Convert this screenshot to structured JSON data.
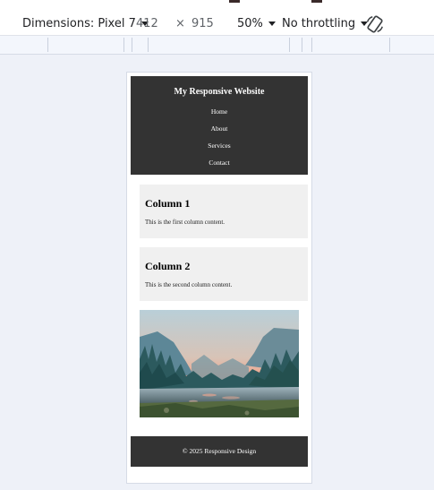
{
  "devtools": {
    "dimensions_label": "Dimensions: Pixel 7",
    "width": "412",
    "times": "×",
    "height": "915",
    "zoom": "50%",
    "throttling": "No throttling"
  },
  "site": {
    "title": "My Responsive Website",
    "nav": [
      "Home",
      "About",
      "Services",
      "Contact"
    ],
    "columns": [
      {
        "title": "Column 1",
        "text": "This is the first column content."
      },
      {
        "title": "Column 2",
        "text": "This is the second column content."
      }
    ],
    "footer": "© 2025 Responsive Design"
  },
  "colors": {
    "header_bg": "#333333",
    "card_bg": "#f0f0f0",
    "canvas_bg": "#eef1f8"
  }
}
